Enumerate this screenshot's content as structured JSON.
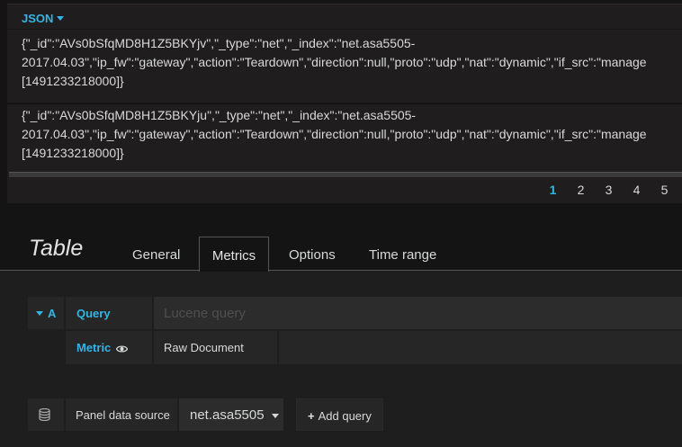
{
  "json_panel": {
    "title": "JSON",
    "rows": [
      {
        "line1": "{\"_id\":\"AVs0bSfqMD8H1Z5BKYjv\",\"_type\":\"net\",\"_index\":\"net.asa5505-",
        "line2": "2017.04.03\",\"ip_fw\":\"gateway\",\"action\":\"Teardown\",\"direction\":null,\"proto\":\"udp\",\"nat\":\"dynamic\",\"if_src\":\"manage",
        "line3": "[1491233218000]}"
      },
      {
        "line1": "{\"_id\":\"AVs0bSfqMD8H1Z5BKYju\",\"_type\":\"net\",\"_index\":\"net.asa5505-",
        "line2": "2017.04.03\",\"ip_fw\":\"gateway\",\"action\":\"Teardown\",\"direction\":null,\"proto\":\"udp\",\"nat\":\"dynamic\",\"if_src\":\"manage",
        "line3": "[1491233218000]}"
      }
    ],
    "pagination": [
      "1",
      "2",
      "3",
      "4",
      "5"
    ],
    "active_page": "1"
  },
  "editor": {
    "title": "Table",
    "tabs": [
      {
        "label": "General"
      },
      {
        "label": "Metrics",
        "active": true
      },
      {
        "label": "Options"
      },
      {
        "label": "Time range"
      }
    ],
    "query": {
      "ref_id": "A",
      "query_label": "Query",
      "query_placeholder": "Lucene query",
      "metric_label": "Metric",
      "metric_value": "Raw Document"
    },
    "footer": {
      "datasource_label": "Panel data source",
      "datasource_value": "net.asa5505",
      "add_query_label": "Add query"
    }
  },
  "colors": {
    "accent": "#33b5e5",
    "background": "#141414",
    "panel": "#1f1d1d",
    "cell": "#262626"
  },
  "icons": [
    "caret-down-icon",
    "eye-icon",
    "database-icon",
    "plus-icon"
  ]
}
